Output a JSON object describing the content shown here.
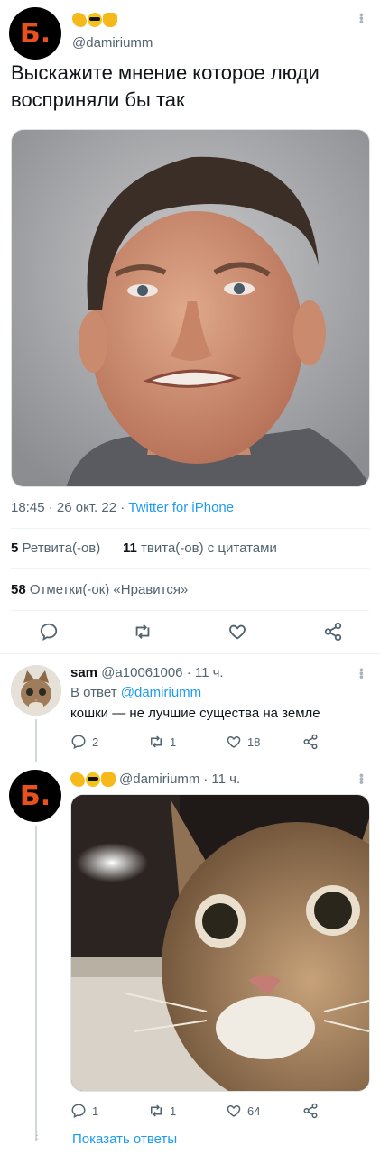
{
  "main_tweet": {
    "avatar_letter": "Б.",
    "handle": "@damiriumm",
    "text": "Выскажите мнение которое люди восприняли бы так",
    "image_alt": "man-skeptical-face",
    "time": "18:45",
    "date": "26 окт. 22",
    "source": "Twitter for iPhone",
    "retweets_count": "5",
    "retweets_label": "Ретвита(-ов)",
    "quotes_count": "11",
    "quotes_label": "твита(-ов) с цитатами",
    "likes_count": "58",
    "likes_label": "Отметки(-ок) «Нравится»"
  },
  "reply_1": {
    "name": "sam",
    "handle": "@a10061006",
    "time": "11 ч.",
    "reply_to_prefix": "В ответ",
    "reply_to_handle": "@damiriumm",
    "text": "кошки — не лучшие существа на земле",
    "replies": "2",
    "retweets": "1",
    "likes": "18"
  },
  "reply_2": {
    "avatar_letter": "Б.",
    "handle": "@damiriumm",
    "time": "11 ч.",
    "image_alt": "cat-close-up",
    "replies": "1",
    "retweets": "1",
    "likes": "64"
  },
  "show_replies": "Показать ответы",
  "colors": {
    "accent": "#1d9bf0",
    "muted": "#536471",
    "avatar_letter": "#e8501e"
  }
}
